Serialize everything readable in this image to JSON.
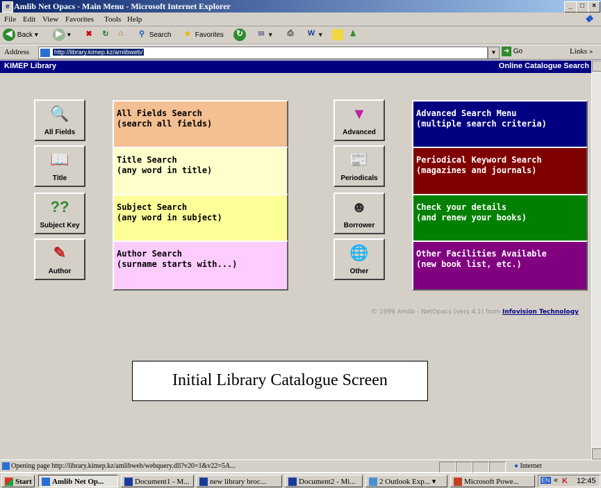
{
  "window": {
    "title": "Amlib Net Opacs - Main Menu  - Microsoft Internet Explorer",
    "controls": [
      "_",
      "□",
      "×"
    ]
  },
  "menu": [
    "File",
    "Edit",
    "View",
    "Favorites",
    "Tools",
    "Help"
  ],
  "toolbar": {
    "back_label": "Back",
    "search_label": "Search",
    "favorites_label": "Favorites"
  },
  "address": {
    "label": "Address",
    "url": "http://library.kimep.kz/amlibweb/",
    "go_label": "Go",
    "links_label": "Links"
  },
  "page": {
    "header_left": "KIMEP Library",
    "header_right": "Online Catalogue Search",
    "left_buttons": [
      {
        "label": "All Fields",
        "icon": "magnifier-icon"
      },
      {
        "label": "Title",
        "icon": "book-icon"
      },
      {
        "label": "Subject Key",
        "icon": "question-marks-icon"
      },
      {
        "label": "Author",
        "icon": "pencil-icon"
      }
    ],
    "left_boxes": [
      {
        "line1": "All Fields Search",
        "line2": "(search all fields)",
        "bg": "#f4bf92",
        "color": "#000000"
      },
      {
        "line1": "Title Search",
        "line2": "(any word in title)",
        "bg": "#ffffcc",
        "color": "#000000"
      },
      {
        "line1": "Subject Search",
        "line2": "(any word in subject)",
        "bg": "#ffff99",
        "color": "#000000"
      },
      {
        "line1": "Author Search",
        "line2": "(surname starts with...)",
        "bg": "#ffccff",
        "color": "#000000"
      }
    ],
    "right_buttons": [
      {
        "label": "Advanced",
        "icon": "funnel-icon"
      },
      {
        "label": "Periodicals",
        "icon": "newspaper-icon"
      },
      {
        "label": "Borrower",
        "icon": "borrower-icon"
      },
      {
        "label": "Other",
        "icon": "globe-icon"
      }
    ],
    "right_boxes": [
      {
        "line1": "Advanced Search Menu",
        "line2": "(multiple search criteria)",
        "bg": "#000080",
        "color": "#ffffff"
      },
      {
        "line1": "Periodical Keyword Search",
        "line2": "(magazines and journals)",
        "bg": "#800000",
        "color": "#ffffff"
      },
      {
        "line1": "Check your details",
        "line2": "(and renew your books)",
        "bg": "#008000",
        "color": "#ffffff"
      },
      {
        "line1": "Other Facilities Available",
        "line2": "(new book list, etc.)",
        "bg": "#800080",
        "color": "#ffffff"
      }
    ],
    "copyright_text": "© 1999 Amlib - NetOpacs (vers 4.1) from ",
    "copyright_link": "Infovision Technology",
    "caption": "Initial Library Catalogue Screen"
  },
  "status": {
    "text": "Opening page http://library.kimep.kz/amlibweb/webquery.dll?v20=1&v22=5A...",
    "zone": "Internet"
  },
  "taskbar": {
    "start_label": "Start",
    "tasks": [
      {
        "label": "Amlib Net Op...",
        "icon": "ie-icon",
        "active": true
      },
      {
        "label": "Document1 - M...",
        "icon": "word-icon",
        "active": false
      },
      {
        "label": "new library broc...",
        "icon": "word-icon",
        "active": false
      },
      {
        "label": "Document2 - Mi...",
        "icon": "word-icon",
        "active": false
      },
      {
        "label": "2 Outlook Exp...",
        "icon": "outlook-icon",
        "active": false
      },
      {
        "label": "Microsoft Powe...",
        "icon": "powerpoint-icon",
        "active": false
      }
    ],
    "tray_lang": "EN",
    "clock": "12:45"
  }
}
